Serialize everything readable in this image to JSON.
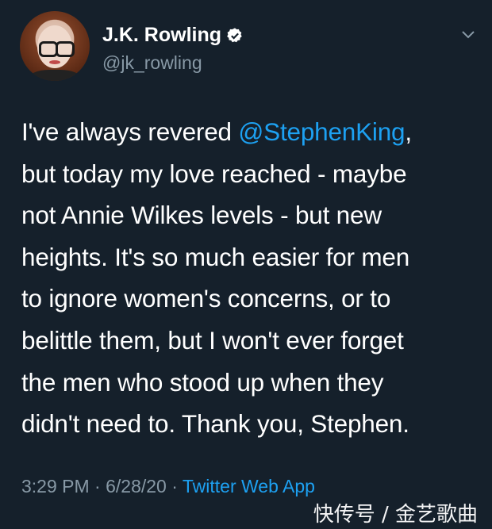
{
  "user": {
    "display_name": "J.K. Rowling",
    "handle": "@jk_rowling",
    "verified": true
  },
  "tweet": {
    "mention": "@StephenKing",
    "lines": [
      "I've always revered ",
      ",",
      "but today my love reached - maybe",
      "not Annie Wilkes levels - but new",
      "heights. It's so much easier for men",
      "to ignore women's concerns, or to",
      "belittle them, but I won't ever forget",
      "the men who stood up when they",
      "didn't need to. Thank you, Stephen."
    ]
  },
  "meta": {
    "time": "3:29 PM",
    "separator": " · ",
    "date": "6/28/20",
    "source": "Twitter Web App"
  },
  "watermark": "快传号 / 金艺歌曲",
  "colors": {
    "background": "#15202b",
    "accent": "#1da1f2",
    "muted": "#8899a6"
  },
  "icons": {
    "verified": "verified-badge-icon",
    "menu": "chevron-down-icon"
  }
}
